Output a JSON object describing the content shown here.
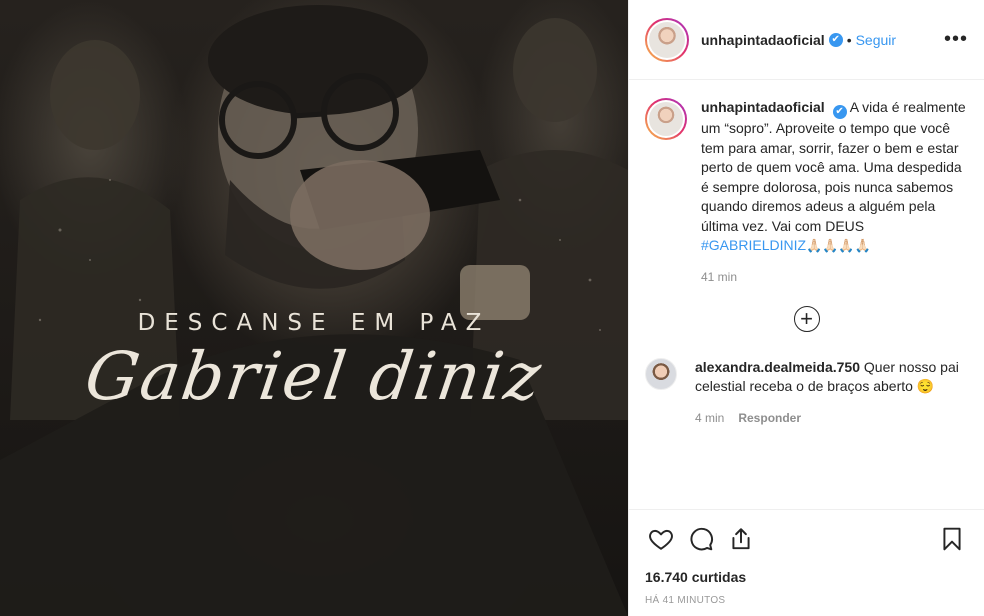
{
  "post": {
    "image": {
      "title_top": "DESCANSE EM PAZ",
      "title_script": "Gabriel diniz"
    }
  },
  "header": {
    "username": "unhapintadaoficial",
    "verified_glyph": "✔",
    "separator": "•",
    "follow_label": "Seguir",
    "more_label": "•••"
  },
  "caption": {
    "username": "unhapintadaoficial",
    "text": " A vida é realmente um “sopro”. Aproveite o tempo que você tem para amar, sorrir, fazer o bem e estar perto de quem você ama. Uma despedida é sempre dolorosa, pois nunca sabemos quando diremos adeus a alguém pela última vez. Vai com DEUS ",
    "hashtag": "#GABRIELDINIZ",
    "emoji": "🙏🏻🙏🏻🙏🏻🙏🏻",
    "time": "41 min"
  },
  "load_more": {
    "glyph": "+"
  },
  "comments": [
    {
      "username": "alexandra.dealmeida.750",
      "text": " Quer nosso pai celestial receba o de braços aberto ",
      "emoji": "😌",
      "time": "4 min",
      "reply_label": "Responder"
    }
  ],
  "actions": {
    "icons": [
      "heart-icon",
      "comment-icon",
      "share-icon",
      "bookmark-icon"
    ]
  },
  "likes": "16.740 curtidas",
  "timestamp": "HÁ 41 MINUTOS",
  "colors": {
    "accent": "#3897f0",
    "text": "#262626",
    "muted": "#8e8e8e",
    "border": "#efefef"
  }
}
